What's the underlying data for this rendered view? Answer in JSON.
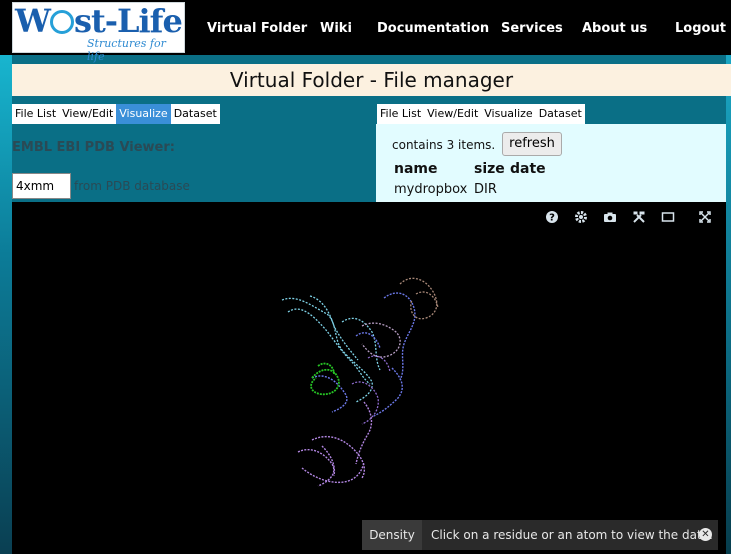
{
  "logo": {
    "name": "West-Life",
    "tagline": "Structures for life"
  },
  "nav": [
    "Virtual Folder",
    "Wiki",
    "Documentation",
    "Services",
    "About us",
    "Logout"
  ],
  "page_title": "Virtual Folder - File manager",
  "left_tabs": [
    "File List",
    "View/Edit",
    "Visualize",
    "Dataset"
  ],
  "left_active_tab": "Visualize",
  "right_tabs": [
    "File List",
    "View/Edit",
    "Visualize",
    "Dataset"
  ],
  "right_active_tab": "File List",
  "viewer": {
    "heading": "EMBL EBI PDB Viewer:",
    "pdb_input_value": "4xmm",
    "pdb_suffix": "from PDB database"
  },
  "file_list": {
    "contains_text": "contains 3 items.",
    "refresh_label": "refresh",
    "columns": [
      "name",
      "size",
      "date"
    ],
    "rows": [
      {
        "name": "mydropbox",
        "size": "DIR",
        "date": ""
      }
    ]
  },
  "viewer_controls": [
    "help-icon",
    "settings-icon",
    "camera-icon",
    "tools-icon",
    "layout-icon",
    "expand-icon"
  ],
  "status_bar": {
    "density_label": "Density",
    "message": "Click on a residue or an atom to view the data."
  },
  "colors": {
    "navbar": "#000000",
    "title_bg": "#fcf1e0",
    "active_tab": "#3a8fd8",
    "right_panel_bg": "#e2fcff",
    "viewer_bg": "#000000",
    "structure_chains": [
      "#7fd3e8",
      "#6b78e8",
      "#b286e2",
      "#26c224",
      "#a88878",
      "#b9a0c6",
      "#8f6cd0"
    ]
  }
}
